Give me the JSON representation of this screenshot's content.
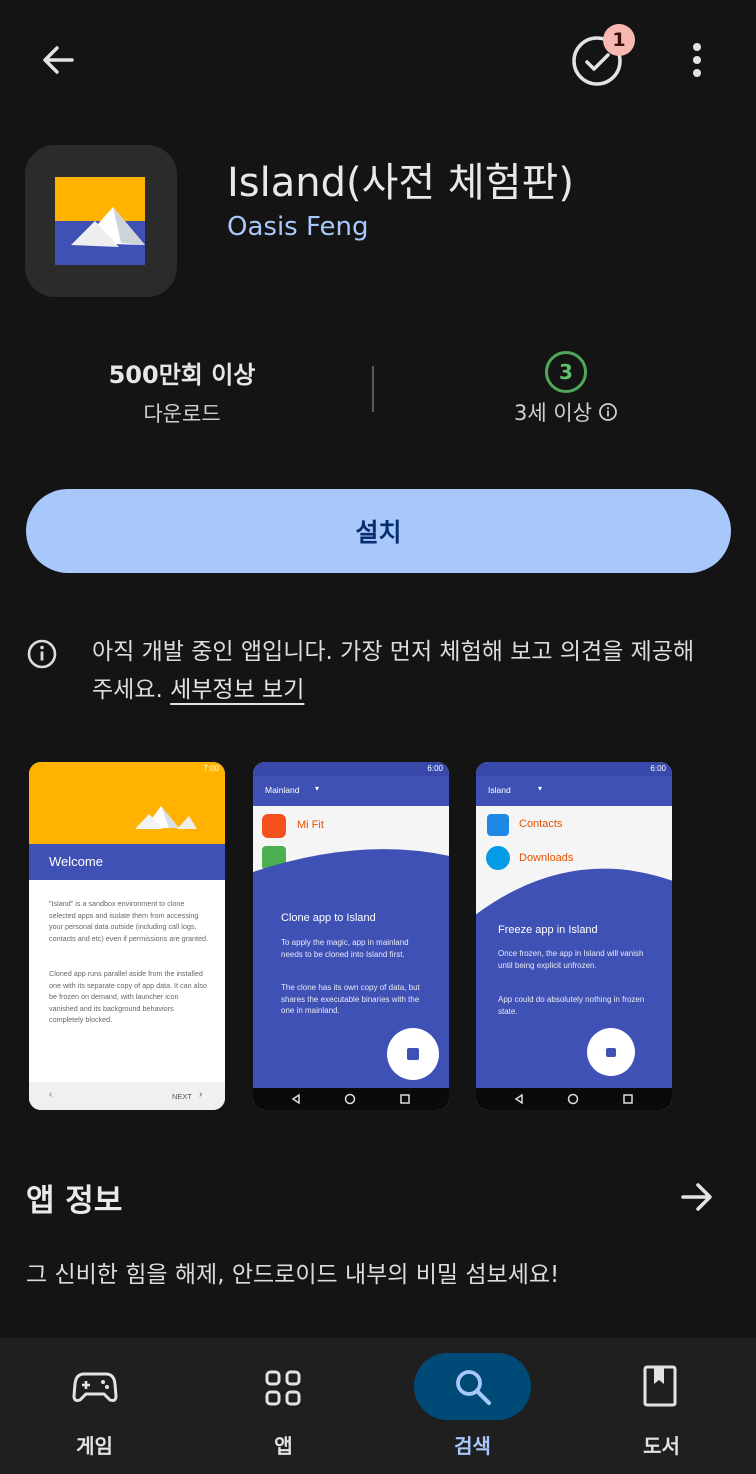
{
  "top_bar": {
    "back_icon": "arrow-left-icon",
    "updates_icon": "check-circle-icon",
    "updates_badge": "1",
    "more_icon": "more-vert-icon"
  },
  "app": {
    "title": "Island(사전 체험판)",
    "developer": "Oasis Feng"
  },
  "stats": {
    "downloads_value": "500만회 이상",
    "downloads_label": "다운로드",
    "rating_badge": "3",
    "rating_label": "3세 이상"
  },
  "install_label": "설치",
  "notice": {
    "text": "아직 개발 중인 앱입니다. 가장 먼저 체험해 보고 의견을 제공해 주세요.",
    "link": "세부정보 보기"
  },
  "screenshots": {
    "shot1": {
      "status_time": "7:00",
      "header": "Welcome",
      "para1": "\"Island\" is a sandbox environment to clone selected apps and isolate them from accessing your personal data outside (including call logs, contacts and etc) even if permissions are granted.",
      "para2": "Cloned app runs parallel aside from the installed one with its separate copy of app data. It can also be frozen on demand, with launcher icon vanished and its background behaviors completely blocked.",
      "next": "NEXT"
    },
    "shot2": {
      "status_time": "6:00",
      "toolbar": "Mainland",
      "item1": "Mi Fit",
      "heading": "Clone app to Island",
      "para1": "To apply the magic, app in mainland needs to be cloned into Island first.",
      "para2": "The clone has its own copy of data, but shares the executable binaries with the one in mainland."
    },
    "shot3": {
      "status_time": "6:00",
      "toolbar": "Island",
      "item1": "Contacts",
      "item2": "Downloads",
      "heading": "Freeze app in Island",
      "para1": "Once frozen, the app in Island will vanish until being explicit unfrozen.",
      "para2": "App could do absolutely nothing in frozen state."
    }
  },
  "about": {
    "title": "앱 정보",
    "description": "그 신비한 힘을 해제, 안드로이드 내부의 비밀 섬보세요!"
  },
  "bottom_nav": [
    {
      "label": "게임",
      "icon": "gamepad-icon"
    },
    {
      "label": "앱",
      "icon": "apps-grid-icon"
    },
    {
      "label": "검색",
      "icon": "search-icon",
      "active": true
    },
    {
      "label": "도서",
      "icon": "book-icon"
    }
  ],
  "colors": {
    "background": "#141414",
    "accent": "#a8c7fa",
    "install_text": "#062e6f",
    "rating_green": "#4ea75a",
    "nav_active_pill": "#004a77",
    "shot_blue": "#3f51b5",
    "shot_amber": "#ffb300"
  }
}
